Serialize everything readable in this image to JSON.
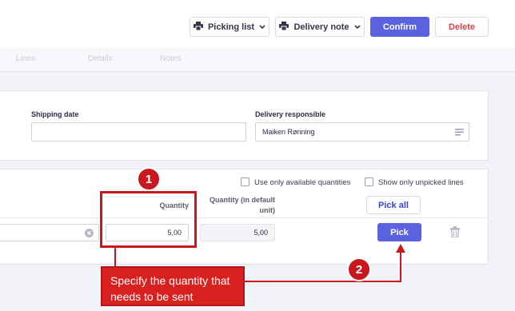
{
  "toolbar": {
    "picking_list_label": "Picking list",
    "delivery_note_label": "Delivery note",
    "confirm_label": "Confirm",
    "delete_label": "Delete"
  },
  "tabs": [
    "Lines",
    "Details",
    "Notes"
  ],
  "form": {
    "shipping_date_label": "Shipping date",
    "shipping_date_value": "",
    "delivery_responsible_label": "Delivery responsible",
    "delivery_responsible_value": "Maiken Rønning"
  },
  "lines": {
    "use_available_label": "Use only available quantities",
    "show_unpicked_label": "Show only unpicked lines",
    "quantity_header": "Quantity",
    "quantity_default_header": "Quantity (in default unit)",
    "pick_all_label": "Pick all",
    "quantity_value": "5,00",
    "quantity_default_value": "5,00",
    "pick_label": "Pick"
  },
  "annotation": {
    "badge_1": "1",
    "badge_2": "2",
    "callout_text": "Specify the quantity that needs to be sent"
  },
  "colors": {
    "accent": "#5b62e0",
    "annotation_red": "#c9181d",
    "danger_text": "#d9414a"
  }
}
